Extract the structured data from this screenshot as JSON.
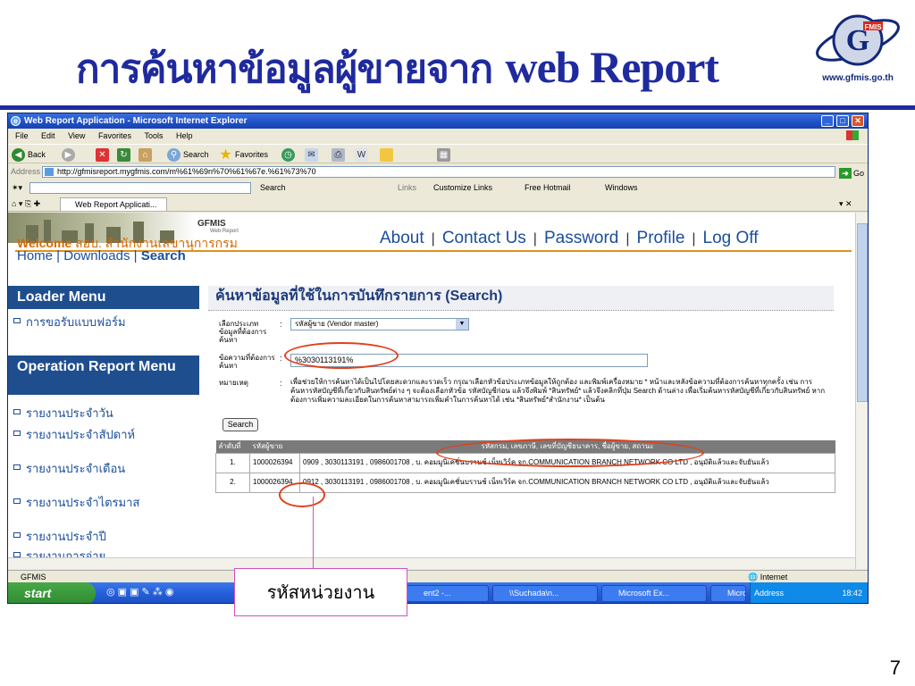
{
  "slide": {
    "title_th": "การค้นหาข้อมูลผู้ขายจาก",
    "title_en": "web Report",
    "logo_url": "www.gfmis.go.th",
    "page_number": "7",
    "callout": "รหัสหน่วยงาน"
  },
  "window": {
    "title": "Web Report Application - Microsoft Internet Explorer",
    "menu": [
      "File",
      "Edit",
      "View",
      "Favorites",
      "Tools",
      "Help"
    ],
    "toolbar": {
      "back": "Back",
      "search": "Search",
      "favorites": "Favorites"
    },
    "address_label": "Address",
    "address": "http://gfmisreport.mygfmis.com/m%61%69n%70%61%67e.%61%73%70",
    "go": "Go",
    "searchbar": {
      "search": "Search",
      "links": "Links",
      "customize": "Customize Links",
      "hotmail": "Free Hotmail",
      "windows": "Windows"
    },
    "tab": "Web Report Applicati...",
    "status_text": "GFMIS",
    "status_zone": "Internet"
  },
  "site": {
    "brand": "GFMIS",
    "brand_sub": "Web Report",
    "welcome_label": "Welcome",
    "welcome_org": "สอบ. สำนักงานเลขานุการกรม",
    "top_links": [
      "About",
      "Contact Us",
      "Password",
      "Profile",
      "Log Off"
    ],
    "sub_links": [
      "Home",
      "Downloads",
      "Search"
    ],
    "loader_menu": {
      "title": "Loader Menu",
      "items": [
        "การขอรับแบบฟอร์ม"
      ]
    },
    "operation_menu": {
      "title": "Operation Report Menu",
      "items": [
        "รายงานประจำวัน",
        "รายงานประจำสัปดาห์",
        "รายงานประจำเดือน",
        "รายงานประจำไตรมาส",
        "รายงานประจำปี",
        "รายงานการจ่าย"
      ]
    }
  },
  "search_page": {
    "title": "ค้นหาข้อมูลที่ใช้ในการบันทึกรายการ (Search)",
    "type_label": "เลือกประเภทข้อมูลที่ต้องการค้นหา",
    "type_value": "รหัสผู้ขาย (Vendor master)",
    "keyword_label": "ข้อความที่ต้องการค้นหา",
    "keyword_value": "%3030113191%",
    "note_label": "หมายเหตุ",
    "note_text": "เพื่อช่วยให้การค้นหาได้เป็นไปโดยสะดวกและรวดเร็ว กรุณาเลือกหัวข้อประเภทข้อมูลให้ถูกต้อง และพิมพ์เครื่องหมาย * หน้าและหลังข้อความที่ต้องการค้นหาทุกครั้ง เช่น การค้นหารหัสบัญชีที่เกี่ยวกับสินทรัพย์ต่าง ๆ จะต้องเลือกหัวข้อ รหัสบัญชีก่อน แล้วจึงพิมพ์ *สินทรัพย์* แล้วจึงคลิกที่ปุ่ม Search ด้านล่าง เพื่อเริ่มค้นหารหัสบัญชีที่เกี่ยวกับสินทรัพย์ หากต้องการเพิ่มความละเอียดในการค้นหาสามารถเพิ่มคำในการค้นหาได้ เช่น *สินทรัพย์*สำนักงาน* เป็นต้น",
    "search_button": "Search",
    "table": {
      "headers": [
        "ลำดับที่",
        "รหัสผู้ขาย",
        "รหัสกรม, เลขภาษี, เลขที่บัญชีธนาคาร, ชื่อผู้ขาย, สถานะ"
      ],
      "rows": [
        {
          "no": "1.",
          "vendor": "1000026394",
          "detail": "0909 , 3030113191 , 0986001708 , บ. คอมมูนิเคชั่นบรานช์ เน็ทเวิร์ค จก.COMMUNICATION BRANCH NETWORK CO LTD , อนุมัติแล้วและจับยันแล้ว"
        },
        {
          "no": "2.",
          "vendor": "1000026394",
          "detail": "0912 , 3030113191 , 0986001708 , บ. คอมมูนิเคชั่นบรานช์ เน็ทเวิร์ค จก.COMMUNICATION BRANCH NETWORK CO LTD , อนุมัติแล้วและจับยันแล้ว"
        }
      ]
    }
  },
  "taskbar": {
    "start": "start",
    "items": [
      "ent2 -...",
      "\\\\Suchada\\n...",
      "Microsoft Ex...",
      "Microsoft Po..."
    ],
    "address": "Address",
    "clock": "18:42"
  }
}
